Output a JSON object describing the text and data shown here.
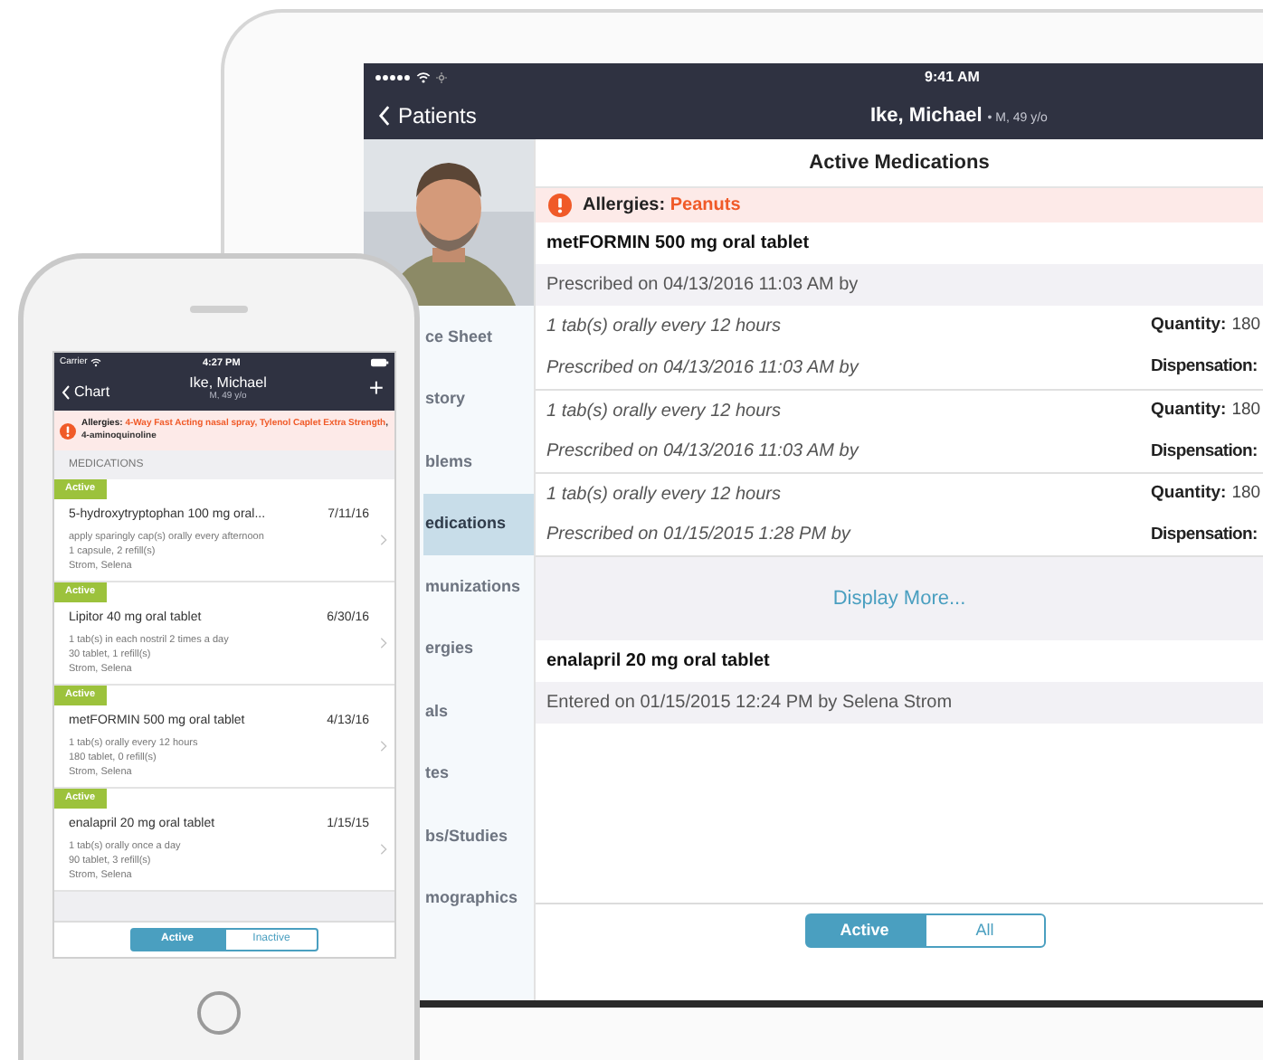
{
  "tablet": {
    "status_bar": {
      "time": "9:41 AM"
    },
    "nav": {
      "back_label": "Patients",
      "patient_name": "Ike, Michael",
      "patient_info": "• M, 49 y/o"
    },
    "sidebar": {
      "items": [
        {
          "label": "ce Sheet",
          "selected": false
        },
        {
          "label": "story",
          "selected": false
        },
        {
          "label": "blems",
          "selected": false
        },
        {
          "label": "edications",
          "selected": true
        },
        {
          "label": "munizations",
          "selected": false
        },
        {
          "label": "ergies",
          "selected": false
        },
        {
          "label": "als",
          "selected": false
        },
        {
          "label": "tes",
          "selected": false
        },
        {
          "label": "bs/Studies",
          "selected": false
        },
        {
          "label": "mographics",
          "selected": false
        }
      ]
    },
    "main": {
      "title": "Active Medications",
      "allergy": {
        "label": "Allergies:",
        "value": "Peanuts"
      },
      "medications": [
        {
          "name": "metFORMIN 500 mg oral tablet",
          "detail": "Prescribed on 04/13/2016 11:03 AM by",
          "entries": [
            {
              "sig": "1 tab(s) orally every 12 hours",
              "prescribed": "Prescribed on 04/13/2016 11:03 AM by",
              "quantity_label": "Quantity:",
              "quantity": "180",
              "dispensation_label": "Dispensation:"
            },
            {
              "sig": "1 tab(s) orally every 12 hours",
              "prescribed": "Prescribed on 04/13/2016 11:03 AM by",
              "quantity_label": "Quantity:",
              "quantity": "180",
              "dispensation_label": "Dispensation:"
            },
            {
              "sig": "1 tab(s) orally every 12 hours",
              "prescribed": "Prescribed on 01/15/2015 1:28 PM by",
              "quantity_label": "Quantity:",
              "quantity": "180",
              "dispensation_label": "Dispensation:"
            }
          ],
          "more_label": "Display More..."
        },
        {
          "name": "enalapril 20 mg oral tablet",
          "detail": "Entered on 01/15/2015 12:24 PM by Selena Strom"
        }
      ],
      "segments": [
        {
          "label": "Active",
          "selected": true
        },
        {
          "label": "All",
          "selected": false
        }
      ]
    }
  },
  "phone": {
    "status_bar": {
      "carrier": "Carrier",
      "time": "4:27 PM"
    },
    "nav": {
      "back_label": "Chart",
      "patient_name": "Ike, Michael",
      "patient_info": "M, 49 y/o",
      "add_label": "+"
    },
    "allergies": {
      "label": "Allergies:",
      "parts": [
        {
          "text": "4-Way Fast Acting nasal spray, Tylenol Caplet Extra Strength",
          "kind": "severe"
        },
        {
          "text": ", 4-aminoquinoline",
          "kind": "normal"
        }
      ]
    },
    "section_header": "MEDICATIONS",
    "medications": [
      {
        "status": "Active",
        "name": "5-hydroxytryptophan 100 mg oral...",
        "date": "7/11/16",
        "lines": [
          "apply sparingly cap(s) orally every afternoon",
          "1 capsule, 2 refill(s)",
          "Strom, Selena"
        ]
      },
      {
        "status": "Active",
        "name": "Lipitor 40 mg oral tablet",
        "date": "6/30/16",
        "lines": [
          "1 tab(s) in each nostril 2 times a day",
          "30 tablet, 1 refill(s)",
          "Strom, Selena"
        ]
      },
      {
        "status": "Active",
        "name": "metFORMIN 500 mg oral tablet",
        "date": "4/13/16",
        "lines": [
          "1 tab(s) orally every 12 hours",
          "180 tablet, 0 refill(s)",
          "Strom, Selena"
        ]
      },
      {
        "status": "Active",
        "name": "enalapril 20 mg oral tablet",
        "date": "1/15/15",
        "lines": [
          "1 tab(s) orally once a day",
          "90 tablet, 3 refill(s)",
          "Strom, Selena"
        ]
      }
    ],
    "segments": [
      {
        "label": "Active",
        "selected": true
      },
      {
        "label": "Inactive",
        "selected": false
      }
    ]
  }
}
